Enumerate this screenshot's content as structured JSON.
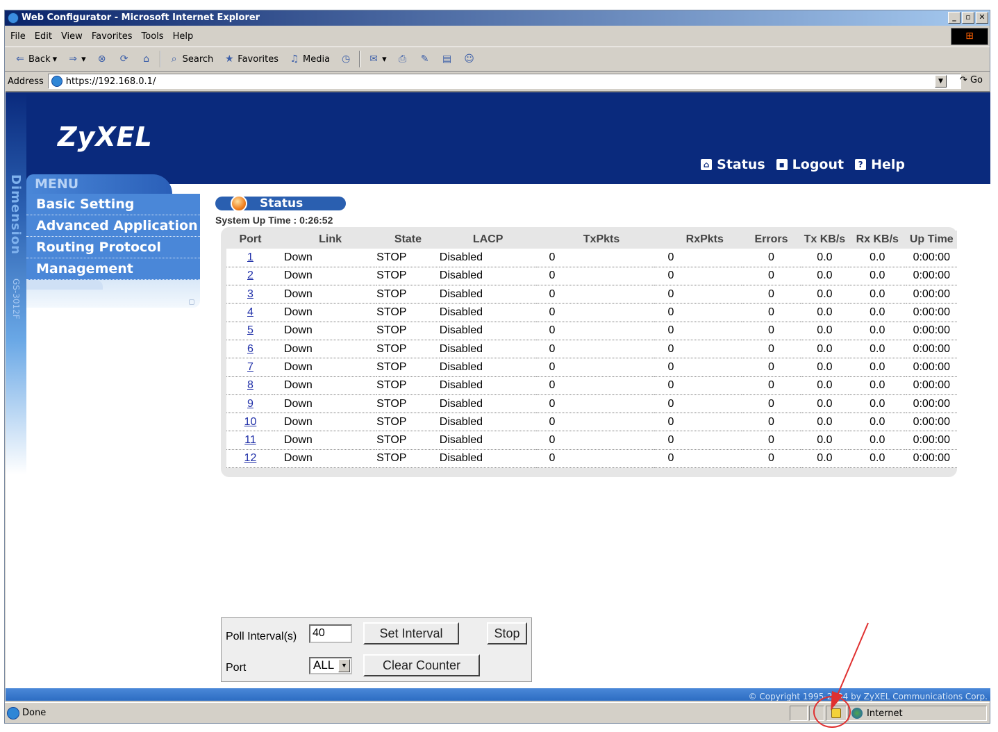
{
  "window": {
    "title": "Web Configurator - Microsoft Internet Explorer",
    "buttons": [
      "_",
      "▫",
      "✕"
    ]
  },
  "menubar": [
    "File",
    "Edit",
    "View",
    "Favorites",
    "Tools",
    "Help"
  ],
  "toolbar": {
    "back": "Back",
    "search": "Search",
    "favorites": "Favorites",
    "media": "Media"
  },
  "address": {
    "label": "Address",
    "url": "https://192.168.0.1/",
    "go": "Go"
  },
  "page": {
    "logo": "ZyXEL",
    "toplinks": {
      "status": "Status",
      "logout": "Logout",
      "help": "Help"
    },
    "side_brand": "Dimension",
    "side_model": "GS-3012F",
    "menu": {
      "title": "MENU",
      "items": [
        "Basic Setting",
        "Advanced Application",
        "Routing Protocol",
        "Management"
      ]
    },
    "status_title": "Status",
    "uptime": "System Up Time : 0:26:52",
    "table": {
      "headers": [
        "Port",
        "Link",
        "State",
        "LACP",
        "TxPkts",
        "RxPkts",
        "Errors",
        "Tx KB/s",
        "Rx KB/s",
        "Up Time"
      ],
      "rows": [
        [
          "1",
          "Down",
          "STOP",
          "Disabled",
          "0",
          "0",
          "0",
          "0.0",
          "0.0",
          "0:00:00"
        ],
        [
          "2",
          "Down",
          "STOP",
          "Disabled",
          "0",
          "0",
          "0",
          "0.0",
          "0.0",
          "0:00:00"
        ],
        [
          "3",
          "Down",
          "STOP",
          "Disabled",
          "0",
          "0",
          "0",
          "0.0",
          "0.0",
          "0:00:00"
        ],
        [
          "4",
          "Down",
          "STOP",
          "Disabled",
          "0",
          "0",
          "0",
          "0.0",
          "0.0",
          "0:00:00"
        ],
        [
          "5",
          "Down",
          "STOP",
          "Disabled",
          "0",
          "0",
          "0",
          "0.0",
          "0.0",
          "0:00:00"
        ],
        [
          "6",
          "Down",
          "STOP",
          "Disabled",
          "0",
          "0",
          "0",
          "0.0",
          "0.0",
          "0:00:00"
        ],
        [
          "7",
          "Down",
          "STOP",
          "Disabled",
          "0",
          "0",
          "0",
          "0.0",
          "0.0",
          "0:00:00"
        ],
        [
          "8",
          "Down",
          "STOP",
          "Disabled",
          "0",
          "0",
          "0",
          "0.0",
          "0.0",
          "0:00:00"
        ],
        [
          "9",
          "Down",
          "STOP",
          "Disabled",
          "0",
          "0",
          "0",
          "0.0",
          "0.0",
          "0:00:00"
        ],
        [
          "10",
          "Down",
          "STOP",
          "Disabled",
          "0",
          "0",
          "0",
          "0.0",
          "0.0",
          "0:00:00"
        ],
        [
          "11",
          "Down",
          "STOP",
          "Disabled",
          "0",
          "0",
          "0",
          "0.0",
          "0.0",
          "0:00:00"
        ],
        [
          "12",
          "Down",
          "STOP",
          "Disabled",
          "0",
          "0",
          "0",
          "0.0",
          "0.0",
          "0:00:00"
        ]
      ]
    },
    "poll": {
      "label": "Poll Interval(s)",
      "value": "40",
      "set_button": "Set Interval",
      "stop_button": "Stop",
      "port_label": "Port",
      "port_selected": "ALL",
      "clear_button": "Clear Counter"
    },
    "copyright": "© Copyright 1995-2004 by ZyXEL Communications Corp."
  },
  "statusbar": {
    "text": "Done",
    "zone": "Internet"
  },
  "colors": {
    "header_bg": "#0a2a7d",
    "menu_bg": "#4a87d8",
    "link": "#1f2fa8",
    "annotation": "#e03030"
  }
}
